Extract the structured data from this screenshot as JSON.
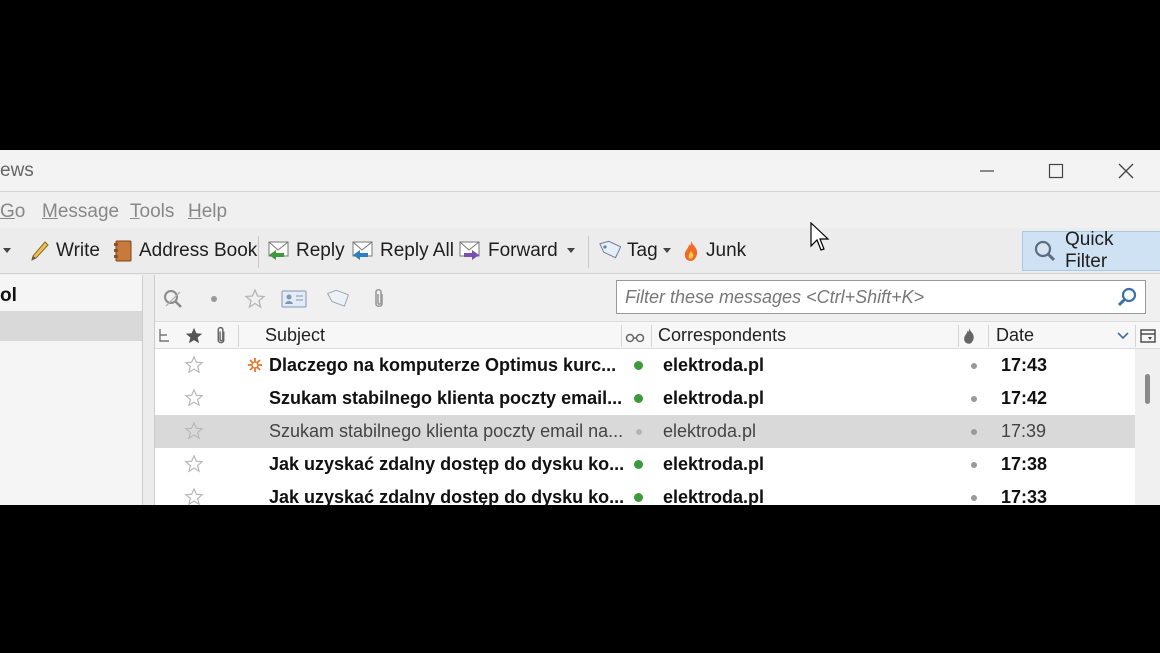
{
  "window": {
    "title": "ews"
  },
  "menu": [
    {
      "label": "Go",
      "access_key": "G",
      "rest": "o"
    },
    {
      "label": "Message",
      "access_key": "M",
      "rest": "essage"
    },
    {
      "label": "Tools",
      "access_key": "T",
      "rest": "ools"
    },
    {
      "label": "Help",
      "access_key": "H",
      "rest": "elp"
    }
  ],
  "toolbar": {
    "write": "Write",
    "address_book": "Address Book",
    "reply": "Reply",
    "reply_all": "Reply All",
    "forward": "Forward",
    "tag": "Tag",
    "junk": "Junk",
    "quick_filter": "Quick Filter"
  },
  "folder_pane": {
    "title": "ol"
  },
  "filter": {
    "placeholder": "Filter these messages <Ctrl+Shift+K>"
  },
  "columns": {
    "subject": "Subject",
    "correspondents": "Correspondents",
    "date": "Date"
  },
  "messages": [
    {
      "subject": "Dlaczego na komputerze Optimus kurc...",
      "correspondent": "elektroda.pl",
      "date": "17:43",
      "unread": true,
      "junk_mark": true,
      "selected": false
    },
    {
      "subject": "Szukam stabilnego klienta poczty email...",
      "correspondent": "elektroda.pl",
      "date": "17:42",
      "unread": true,
      "junk_mark": false,
      "selected": false
    },
    {
      "subject": "Szukam stabilnego klienta poczty email na...",
      "correspondent": "elektroda.pl",
      "date": "17:39",
      "unread": false,
      "junk_mark": false,
      "selected": true
    },
    {
      "subject": "Jak uzyskać zdalny dostęp do dysku ko...",
      "correspondent": "elektroda.pl",
      "date": "17:38",
      "unread": true,
      "junk_mark": false,
      "selected": false
    },
    {
      "subject": "Jak uzyskać zdalny dostęp do dysku ko...",
      "correspondent": "elektroda.pl",
      "date": "17:33",
      "unread": true,
      "junk_mark": false,
      "selected": false
    }
  ],
  "colors": {
    "unread_dot": "#3c9a3c",
    "read_dot": "#b5b5b5",
    "quick_filter_active": "#cfe2f3",
    "selected_row": "#d9d9d9",
    "junk_mark": "#e8772e"
  }
}
